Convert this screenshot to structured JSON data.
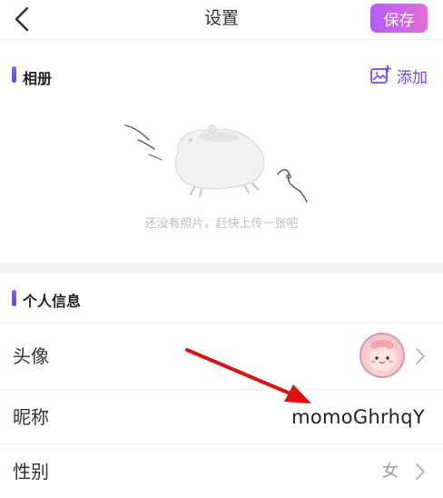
{
  "navbar": {
    "title": "设置",
    "save_label": "保存"
  },
  "album": {
    "title": "相册",
    "add_label": "添加",
    "empty_text": "还没有照片，赶快上传一张吧"
  },
  "profile": {
    "title": "个人信息",
    "rows": [
      {
        "label": "头像"
      },
      {
        "label": "昵称",
        "value": "momoGhrhqY"
      },
      {
        "label": "性别",
        "value": "女"
      }
    ]
  },
  "colors": {
    "accent": "#7a45f0",
    "save_gradient_start": "#b25dfa",
    "save_gradient_end": "#e46fd6",
    "annotation_arrow": "#e01010"
  }
}
